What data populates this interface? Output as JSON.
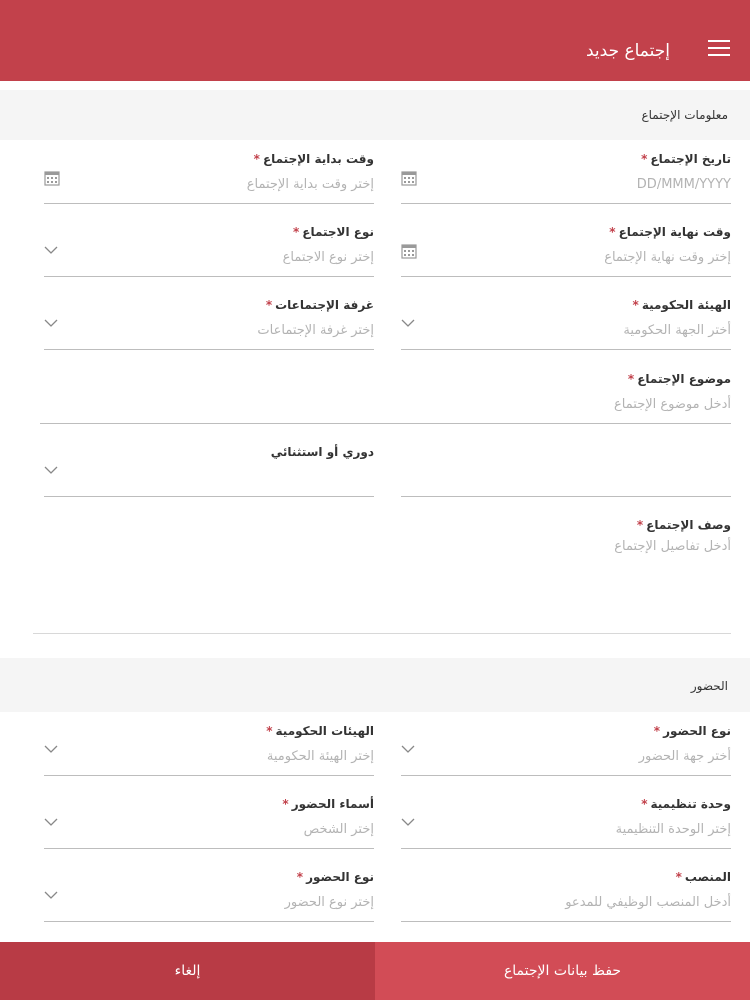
{
  "header": {
    "title": "إجتماع جديد"
  },
  "sections": {
    "meeting_info": "معلومات الإجتماع",
    "attendance": "الحضور"
  },
  "fields": {
    "meeting_date": {
      "label": "تاريخ الإجتماع",
      "placeholder": "DD/MMM/YYYY",
      "required": "*"
    },
    "start_time": {
      "label": "وقت بداية الإجتماع",
      "placeholder": "إختر وقت بداية الإجتماع",
      "required": "*"
    },
    "end_time": {
      "label": "وقت نهاية الإجتماع",
      "placeholder": "إختر وقت نهاية الإجتماع",
      "required": "*"
    },
    "meeting_type": {
      "label": "نوع الاجتماع",
      "placeholder": "إختر نوع الاجتماع",
      "required": "*"
    },
    "gov_entity": {
      "label": "الهيئة الحكومية",
      "placeholder": "أختر الجهة الحكومية",
      "required": "*"
    },
    "meeting_room": {
      "label": "غرفة الإجتماعات",
      "placeholder": "إختر غرفة الإجتماعات",
      "required": "*"
    },
    "meeting_subject": {
      "label": "موضوع الإجتماع",
      "placeholder": "أدخل موضوع الإجتماع",
      "required": "*"
    },
    "periodic": {
      "label": "دوري أو استثنائي",
      "placeholder": ""
    },
    "meeting_desc": {
      "label": "وصف الإجتماع",
      "placeholder": "أدخل تفاصيل الإجتماع",
      "required": "*"
    },
    "attendance_type": {
      "label": "نوع الحضور",
      "placeholder": "أختر جهة الحضور",
      "required": "*"
    },
    "gov_entities": {
      "label": "الهيئات الحكومية",
      "placeholder": "إختر الهيئة الحكومية",
      "required": "*"
    },
    "org_unit": {
      "label": "وحدة تنظيمية",
      "placeholder": "إختر الوحدة التنظيمية",
      "required": "*"
    },
    "attendee_names": {
      "label": "أسماء الحضور",
      "placeholder": "إختر الشخص",
      "required": "*"
    },
    "position": {
      "label": "المنصب",
      "placeholder": "أدخل المنصب الوظيفي للمدعو",
      "required": "*"
    },
    "attendance_type2": {
      "label": "نوع الحضور",
      "placeholder": "إختر نوع الحضور",
      "required": "*"
    }
  },
  "buttons": {
    "cancel": "إلغاء",
    "save": "حفظ بيانات الإجتماع"
  },
  "colors": {
    "brand": "#c2414b",
    "required": "#c2414b"
  }
}
